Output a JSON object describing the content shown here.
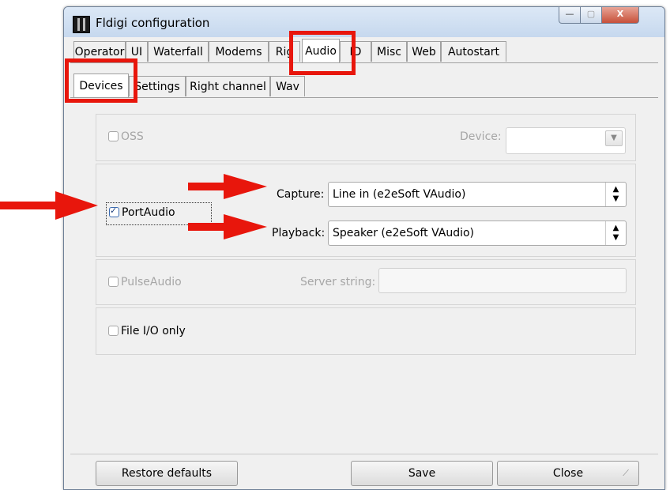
{
  "window": {
    "title": "Fldigi configuration",
    "buttons": {
      "minimize": "—",
      "maximize": "▢",
      "close": "X"
    }
  },
  "tabs_main": [
    {
      "label": "Operator"
    },
    {
      "label": "UI"
    },
    {
      "label": "Waterfall"
    },
    {
      "label": "Modems"
    },
    {
      "label": "Rig"
    },
    {
      "label": "Audio",
      "active": true
    },
    {
      "label": "ID"
    },
    {
      "label": "Misc"
    },
    {
      "label": "Web"
    },
    {
      "label": "Autostart"
    }
  ],
  "tabs_sub": [
    {
      "label": "Devices",
      "active": true
    },
    {
      "label": "Settings"
    },
    {
      "label": "Right channel"
    },
    {
      "label": "Wav"
    }
  ],
  "devices": {
    "oss": {
      "label": "OSS",
      "checked": false,
      "enabled": false,
      "device_label": "Device:",
      "device_value": ""
    },
    "portaudio": {
      "label": "PortAudio",
      "checked": true,
      "enabled": true,
      "capture_label": "Capture:",
      "capture_value": "Line in (e2eSoft VAudio)",
      "playback_label": "Playback:",
      "playback_value": "Speaker (e2eSoft VAudio)"
    },
    "pulseaudio": {
      "label": "PulseAudio",
      "checked": false,
      "enabled": false,
      "server_label": "Server string:",
      "server_value": ""
    },
    "fileio": {
      "label": "File I/O only",
      "checked": false,
      "enabled": true
    }
  },
  "footer": {
    "restore_label": "Restore defaults",
    "save_label": "Save",
    "close_label": "Close"
  },
  "annotation_color": "#e8160c"
}
